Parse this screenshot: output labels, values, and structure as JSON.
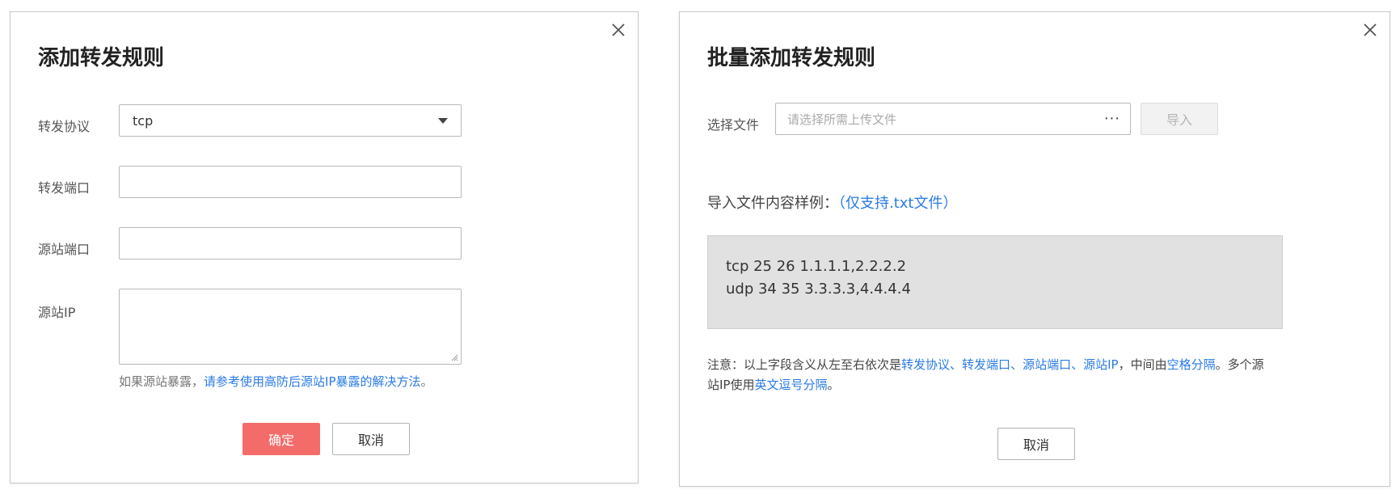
{
  "left_dialog": {
    "title": "添加转发规则",
    "protocol_label": "转发协议",
    "protocol_value": "tcp",
    "forward_port_label": "转发端口",
    "forward_port_value": "",
    "source_port_label": "源站端口",
    "source_port_value": "",
    "source_ip_label": "源站IP",
    "source_ip_value": "",
    "hint_prefix": "如果源站暴露，",
    "hint_link": "请参考使用高防后源站IP暴露的解决方法",
    "hint_suffix": "。",
    "confirm_label": "确定",
    "cancel_label": "取消",
    "colors": {
      "primary": "#f36c6a",
      "link": "#2a7be4"
    }
  },
  "right_dialog": {
    "title": "批量添加转发规则",
    "file_label": "选择文件",
    "file_placeholder": "请选择所需上传文件",
    "more_glyph": "···",
    "import_label": "导入",
    "sample_title": "导入文件内容样例：",
    "sample_note": "（仅支持.txt文件）",
    "sample_lines": [
      "tcp 25 26 1.1.1.1,2.2.2.2",
      "udp 34 35 3.3.3.3,4.4.4.4"
    ],
    "note": {
      "p1": "注意：以上字段含义从左至右依次是",
      "l1": "转发协议",
      "s1": "、",
      "l2": "转发端口",
      "s2": "、",
      "l3": "源站端口",
      "s3": "、",
      "l4": "源站IP",
      "p2": "，中间由",
      "l5": "空格分隔",
      "p3": "。多个源",
      "p4": "站IP使用",
      "l6": "英文逗号分隔",
      "p5": "。"
    },
    "cancel_label": "取消"
  },
  "icons": {
    "close": "close-icon",
    "dropdown": "chevron-down-icon",
    "more": "more-icon",
    "resize": "resize-handle-icon"
  }
}
